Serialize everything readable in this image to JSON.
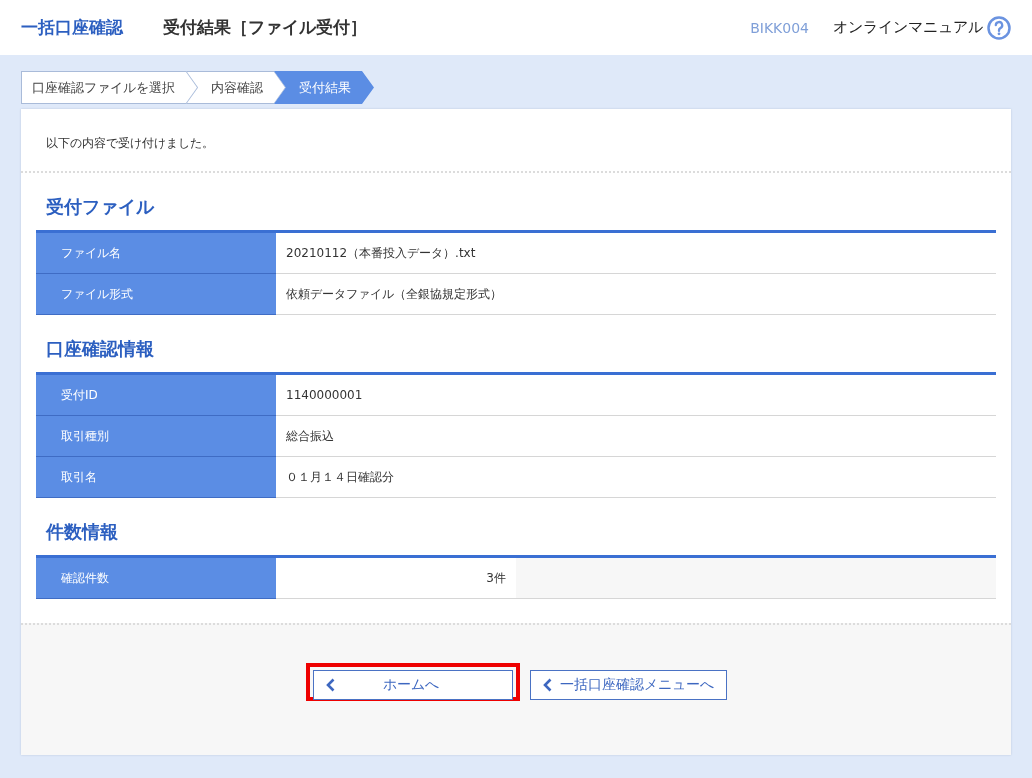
{
  "header": {
    "app_title": "一括口座確認",
    "page_title": "受付結果［ファイル受付］",
    "screen_id": "BIKK004",
    "manual_link": "オンラインマニュアル"
  },
  "steps": [
    {
      "label": "口座確認ファイルを選択",
      "selected": false
    },
    {
      "label": "内容確認",
      "selected": false
    },
    {
      "label": "受付結果",
      "selected": true
    }
  ],
  "message": "以下の内容で受け付けました。",
  "sections": [
    {
      "title": "受付ファイル",
      "rows": [
        {
          "kind": "text",
          "label": "ファイル名",
          "value": "20210112（本番投入データ）.txt"
        },
        {
          "kind": "text",
          "label": "ファイル形式",
          "value": "依頼データファイル（全銀協規定形式）"
        }
      ]
    },
    {
      "title": "口座確認情報",
      "rows": [
        {
          "kind": "text",
          "label": "受付ID",
          "value": "1140000001"
        },
        {
          "kind": "text",
          "label": "取引種別",
          "value": "総合振込"
        },
        {
          "kind": "text",
          "label": "取引名",
          "value": "０１月１４日確認分"
        }
      ]
    },
    {
      "title": "件数情報",
      "rows": [
        {
          "kind": "count",
          "label": "確認件数",
          "value": "3件"
        }
      ]
    }
  ],
  "buttons": [
    {
      "label": "ホームへ",
      "highlighted": true
    },
    {
      "label": "一括口座確認メニューへ",
      "highlighted": false
    }
  ]
}
